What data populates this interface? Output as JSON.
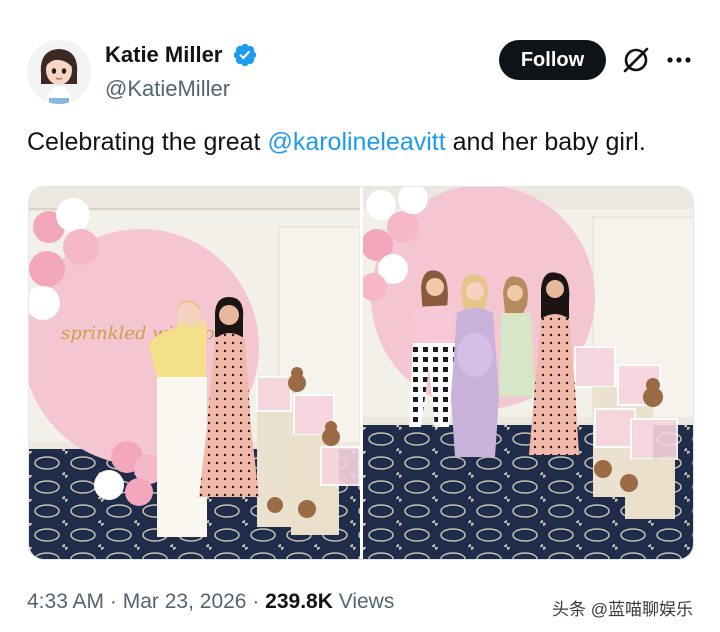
{
  "author": {
    "display_name": "Katie Miller",
    "handle": "@KatieMiller",
    "avatar_icon": "cartoon-avatar-icon",
    "verified_icon": "verified-badge-icon",
    "verified_color": "#1d9bf0"
  },
  "actions": {
    "follow_label": "Follow",
    "grok_icon": "grok-icon",
    "more_icon": "more-horizontal-icon"
  },
  "tweet": {
    "text_before": "Celebrating the great ",
    "mention": "@karolineleavitt",
    "text_after": " and her baby girl.",
    "mention_color": "#1d9bf0"
  },
  "media": {
    "count": 2,
    "backdrop_sign": "sprinkled with love"
  },
  "meta": {
    "time": "4:33 AM",
    "separator1": " · ",
    "date": "Mar 23, 2026",
    "separator2": " · ",
    "views_count": "239.8K",
    "views_label": " Views"
  },
  "watermark": "头条 @蓝喵聊娱乐"
}
